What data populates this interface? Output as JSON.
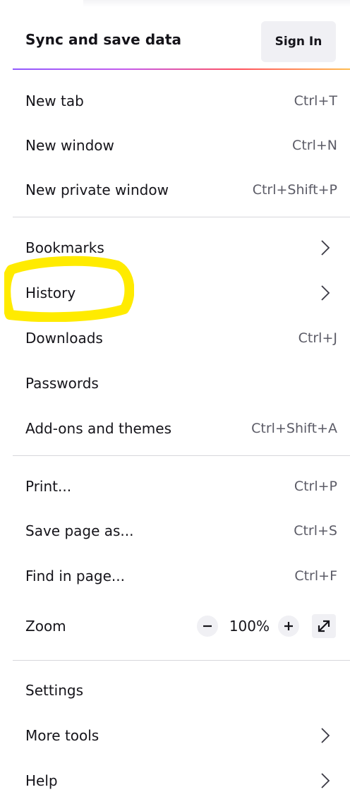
{
  "header": {
    "title": "Sync and save data",
    "signin_label": "Sign In"
  },
  "items": {
    "new_tab": {
      "label": "New tab",
      "shortcut": "Ctrl+T"
    },
    "new_window": {
      "label": "New window",
      "shortcut": "Ctrl+N"
    },
    "new_private_window": {
      "label": "New private window",
      "shortcut": "Ctrl+Shift+P"
    },
    "bookmarks": {
      "label": "Bookmarks",
      "icon": "chevron-right-icon"
    },
    "history": {
      "label": "History",
      "icon": "chevron-right-icon"
    },
    "downloads": {
      "label": "Downloads",
      "shortcut": "Ctrl+J"
    },
    "passwords": {
      "label": "Passwords"
    },
    "addons": {
      "label": "Add-ons and themes",
      "shortcut": "Ctrl+Shift+A"
    },
    "print": {
      "label": "Print...",
      "shortcut": "Ctrl+P"
    },
    "save_page": {
      "label": "Save page as...",
      "shortcut": "Ctrl+S"
    },
    "find": {
      "label": "Find in page...",
      "shortcut": "Ctrl+F"
    },
    "zoom": {
      "label": "Zoom",
      "value": "100%",
      "decrease_icon": "minus-icon",
      "increase_icon": "plus-icon",
      "fullscreen_icon": "fullscreen-arrow-icon"
    },
    "settings": {
      "label": "Settings"
    },
    "more_tools": {
      "label": "More tools",
      "icon": "chevron-right-icon"
    },
    "help": {
      "label": "Help",
      "icon": "chevron-right-icon"
    }
  },
  "annotation": {
    "highlight_color": "#ffeb00",
    "highlighted_item": "History"
  },
  "colors": {
    "text": "#15141a",
    "secondary_text": "#5b5b66",
    "button_bg": "#f0f0f4",
    "separator": "#d7d7db"
  }
}
